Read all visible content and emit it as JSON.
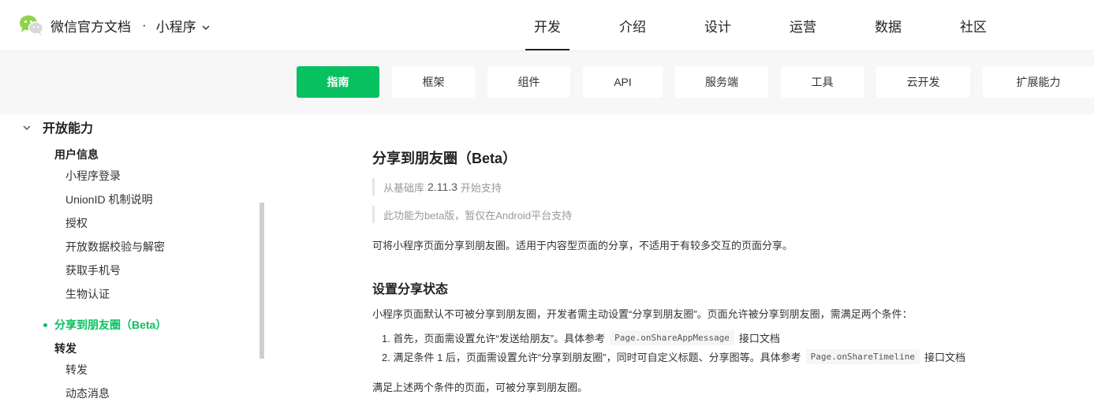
{
  "header": {
    "brand_text": "微信官方文档",
    "separator": "·",
    "product": "小程序",
    "nav": [
      "开发",
      "介绍",
      "设计",
      "运营",
      "数据",
      "社区"
    ],
    "active_nav_index": 0
  },
  "tabs": {
    "items": [
      "指南",
      "框架",
      "组件",
      "API",
      "服务端",
      "工具",
      "云开发",
      "扩展能力"
    ],
    "active_index": 0
  },
  "sidebar": {
    "section": "开放能力",
    "groups": {
      "user_info": "用户信息",
      "forward": "转发"
    },
    "items": {
      "login": "小程序登录",
      "unionid": "UnionID 机制说明",
      "auth": "授权",
      "data_verify": "开放数据校验与解密",
      "phone": "获取手机号",
      "bio": "生物认证",
      "share_timeline": "分享到朋友圈（Beta）",
      "forward": "转发",
      "dynamic_msg": "动态消息"
    }
  },
  "content": {
    "title": "分享到朋友圈（Beta）",
    "note1_prefix": "从基础库",
    "note1_version": "2.11.3",
    "note1_suffix": "开始支持",
    "note2": "此功能为beta版，暂仅在Android平台支持",
    "intro": "可将小程序页面分享到朋友圈。适用于内容型页面的分享，不适用于有较多交互的页面分享。",
    "section_title": "设置分享状态",
    "section_desc": "小程序页面默认不可被分享到朋友圈，开发者需主动设置“分享到朋友圈”。页面允许被分享到朋友圈，需满足两个条件：",
    "step1_prefix": "1. 首先，页面需设置允许“发送给朋友”。具体参考",
    "step1_code": "Page.onShareAppMessage",
    "step1_suffix": "接口文档",
    "step2_prefix": "2. 满足条件 1 后，页面需设置允许“分享到朋友圈”，同时可自定义标题、分享图等。具体参考",
    "step2_code": "Page.onShareTimeline",
    "step2_suffix": "接口文档",
    "conclusion": "满足上述两个条件的页面，可被分享到朋友圈。"
  },
  "colors": {
    "accent": "#07c160",
    "logo_green": "#8ed44b"
  },
  "icons": {
    "logo": "wechat-logo-icon",
    "dropdown": "chevron-down-icon",
    "section_toggle": "chevron-down-icon"
  }
}
